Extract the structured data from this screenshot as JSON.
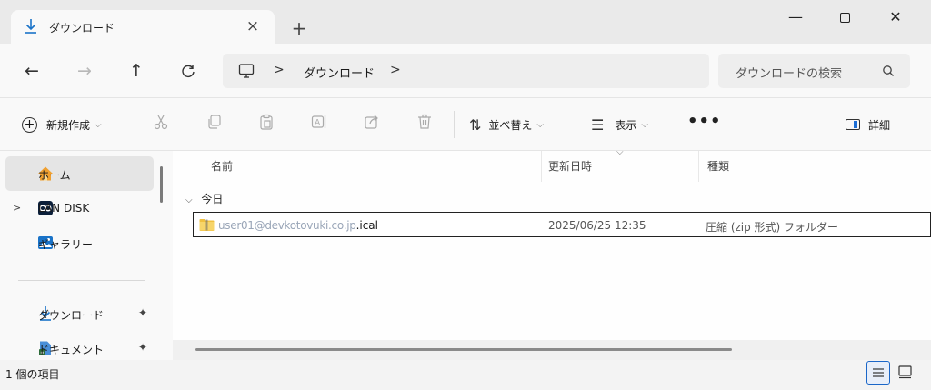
{
  "window": {
    "tab_title": "ダウンロード",
    "tab_close": "×",
    "tab_new": "+",
    "minimize": "—",
    "close": "✕"
  },
  "nav": {
    "back": "←",
    "forward": "→",
    "up": "↑",
    "refresh": "C"
  },
  "address": {
    "separator": ">",
    "crumb": "ダウンロード"
  },
  "search": {
    "placeholder": "ダウンロードの検索"
  },
  "commandbar": {
    "new_label": "新規作成",
    "sort_label": "並べ替え",
    "view_label": "表示",
    "more": "•••",
    "details_label": "詳細"
  },
  "sidebar": {
    "items": [
      {
        "label": "ホーム",
        "icon": "home-icon"
      },
      {
        "label": "LAN DISK",
        "icon": "lan-disk-icon"
      },
      {
        "label": "ギャラリー",
        "icon": "gallery-icon"
      },
      {
        "label": "ダウンロード",
        "icon": "download-icon"
      },
      {
        "label": "ドキュメント",
        "icon": "document-icon"
      }
    ]
  },
  "table": {
    "columns": [
      "名前",
      "更新日時",
      "種類"
    ],
    "group": "今日",
    "rows": [
      {
        "name_obscured": "user01@devkotovuki.co.jp",
        "name_suffix": ".ical",
        "date": "2025/06/25 12:35",
        "type": "圧縮 (zip 形式) フォルダー"
      }
    ]
  },
  "status": {
    "item_count": "1 個の項目"
  },
  "colors": {
    "accent": "#1e6fd6",
    "home": "#f0a030",
    "download": "#1a73c8"
  }
}
